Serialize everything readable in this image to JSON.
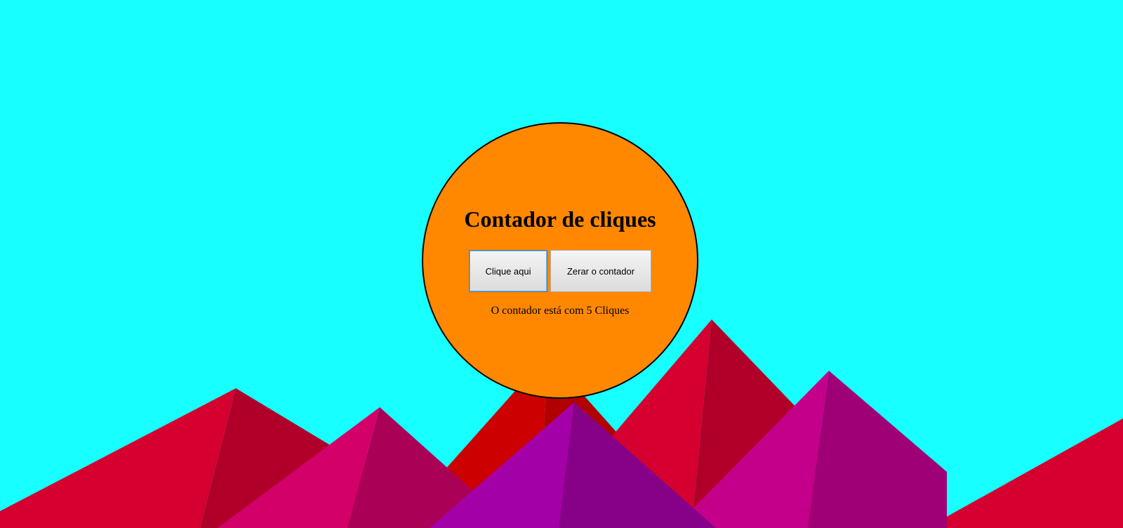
{
  "colors": {
    "sky": "#17ffff",
    "sun": "#ff8800",
    "mountain_red_light": "#d5002f",
    "mountain_red_dark": "#b0002a",
    "mountain_crimson": "#cc0000",
    "mountain_crimson_dark": "#b00000",
    "mountain_pink_light": "#d4006a",
    "mountain_pink_dark": "#aa0055",
    "mountain_magenta_light": "#c4008a",
    "mountain_magenta_dark": "#a00075",
    "mountain_purple_light": "#a400a8",
    "mountain_purple_dark": "#870088"
  },
  "counter": {
    "title": "Contador de cliques",
    "click_button_label": "Clique aqui",
    "reset_button_label": "Zerar o contador",
    "status_text": "O contador está com 5 Cliques"
  }
}
